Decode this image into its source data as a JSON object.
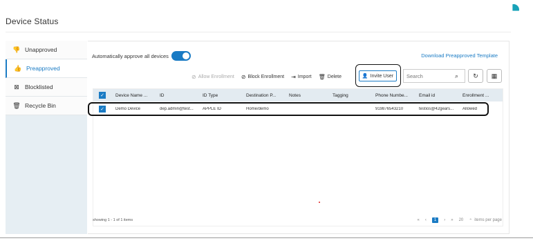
{
  "page": {
    "title": "Device Status"
  },
  "sidebar": {
    "items": [
      {
        "label": "Unapproved",
        "icon": "thumbs-down-icon"
      },
      {
        "label": "Preapproved",
        "icon": "thumbs-up-icon"
      },
      {
        "label": "Blocklisted",
        "icon": "blocked-icon"
      },
      {
        "label": "Recycle Bin",
        "icon": "trash-icon"
      }
    ]
  },
  "main": {
    "auto_approve_label": "Automatically approve all devices",
    "auto_approve_on": true,
    "download_link": "Download Preapproved Template",
    "toolbar": {
      "allow_enrollment": "Allow Enrollment",
      "block_enrollment": "Block Enrollment",
      "import": "Import",
      "delete": "Delete",
      "invite_user": "Invite User"
    },
    "search": {
      "placeholder": "Search"
    },
    "table": {
      "columns": [
        "Device Name ...",
        "ID",
        "ID Type",
        "Destination P...",
        "Notes",
        "Tagging",
        "Phone Numbe...",
        "Email id",
        "Enrollment ..."
      ],
      "rows": [
        [
          "Demo Device",
          "dep.admin@test...",
          "APPLE ID",
          "Home/demo",
          "",
          "",
          "919876543210",
          "testios@42gears...",
          "Allowed"
        ]
      ]
    },
    "footer": {
      "showing": "showing 1 - 1 of 1 items",
      "current_page": "1",
      "page_size": "20",
      "items_per_page": "items per page"
    }
  },
  "colors": {
    "accent": "#1a7bc4",
    "header_bg": "#e3ebf1",
    "sidebar_bg": "#e6eef3"
  }
}
